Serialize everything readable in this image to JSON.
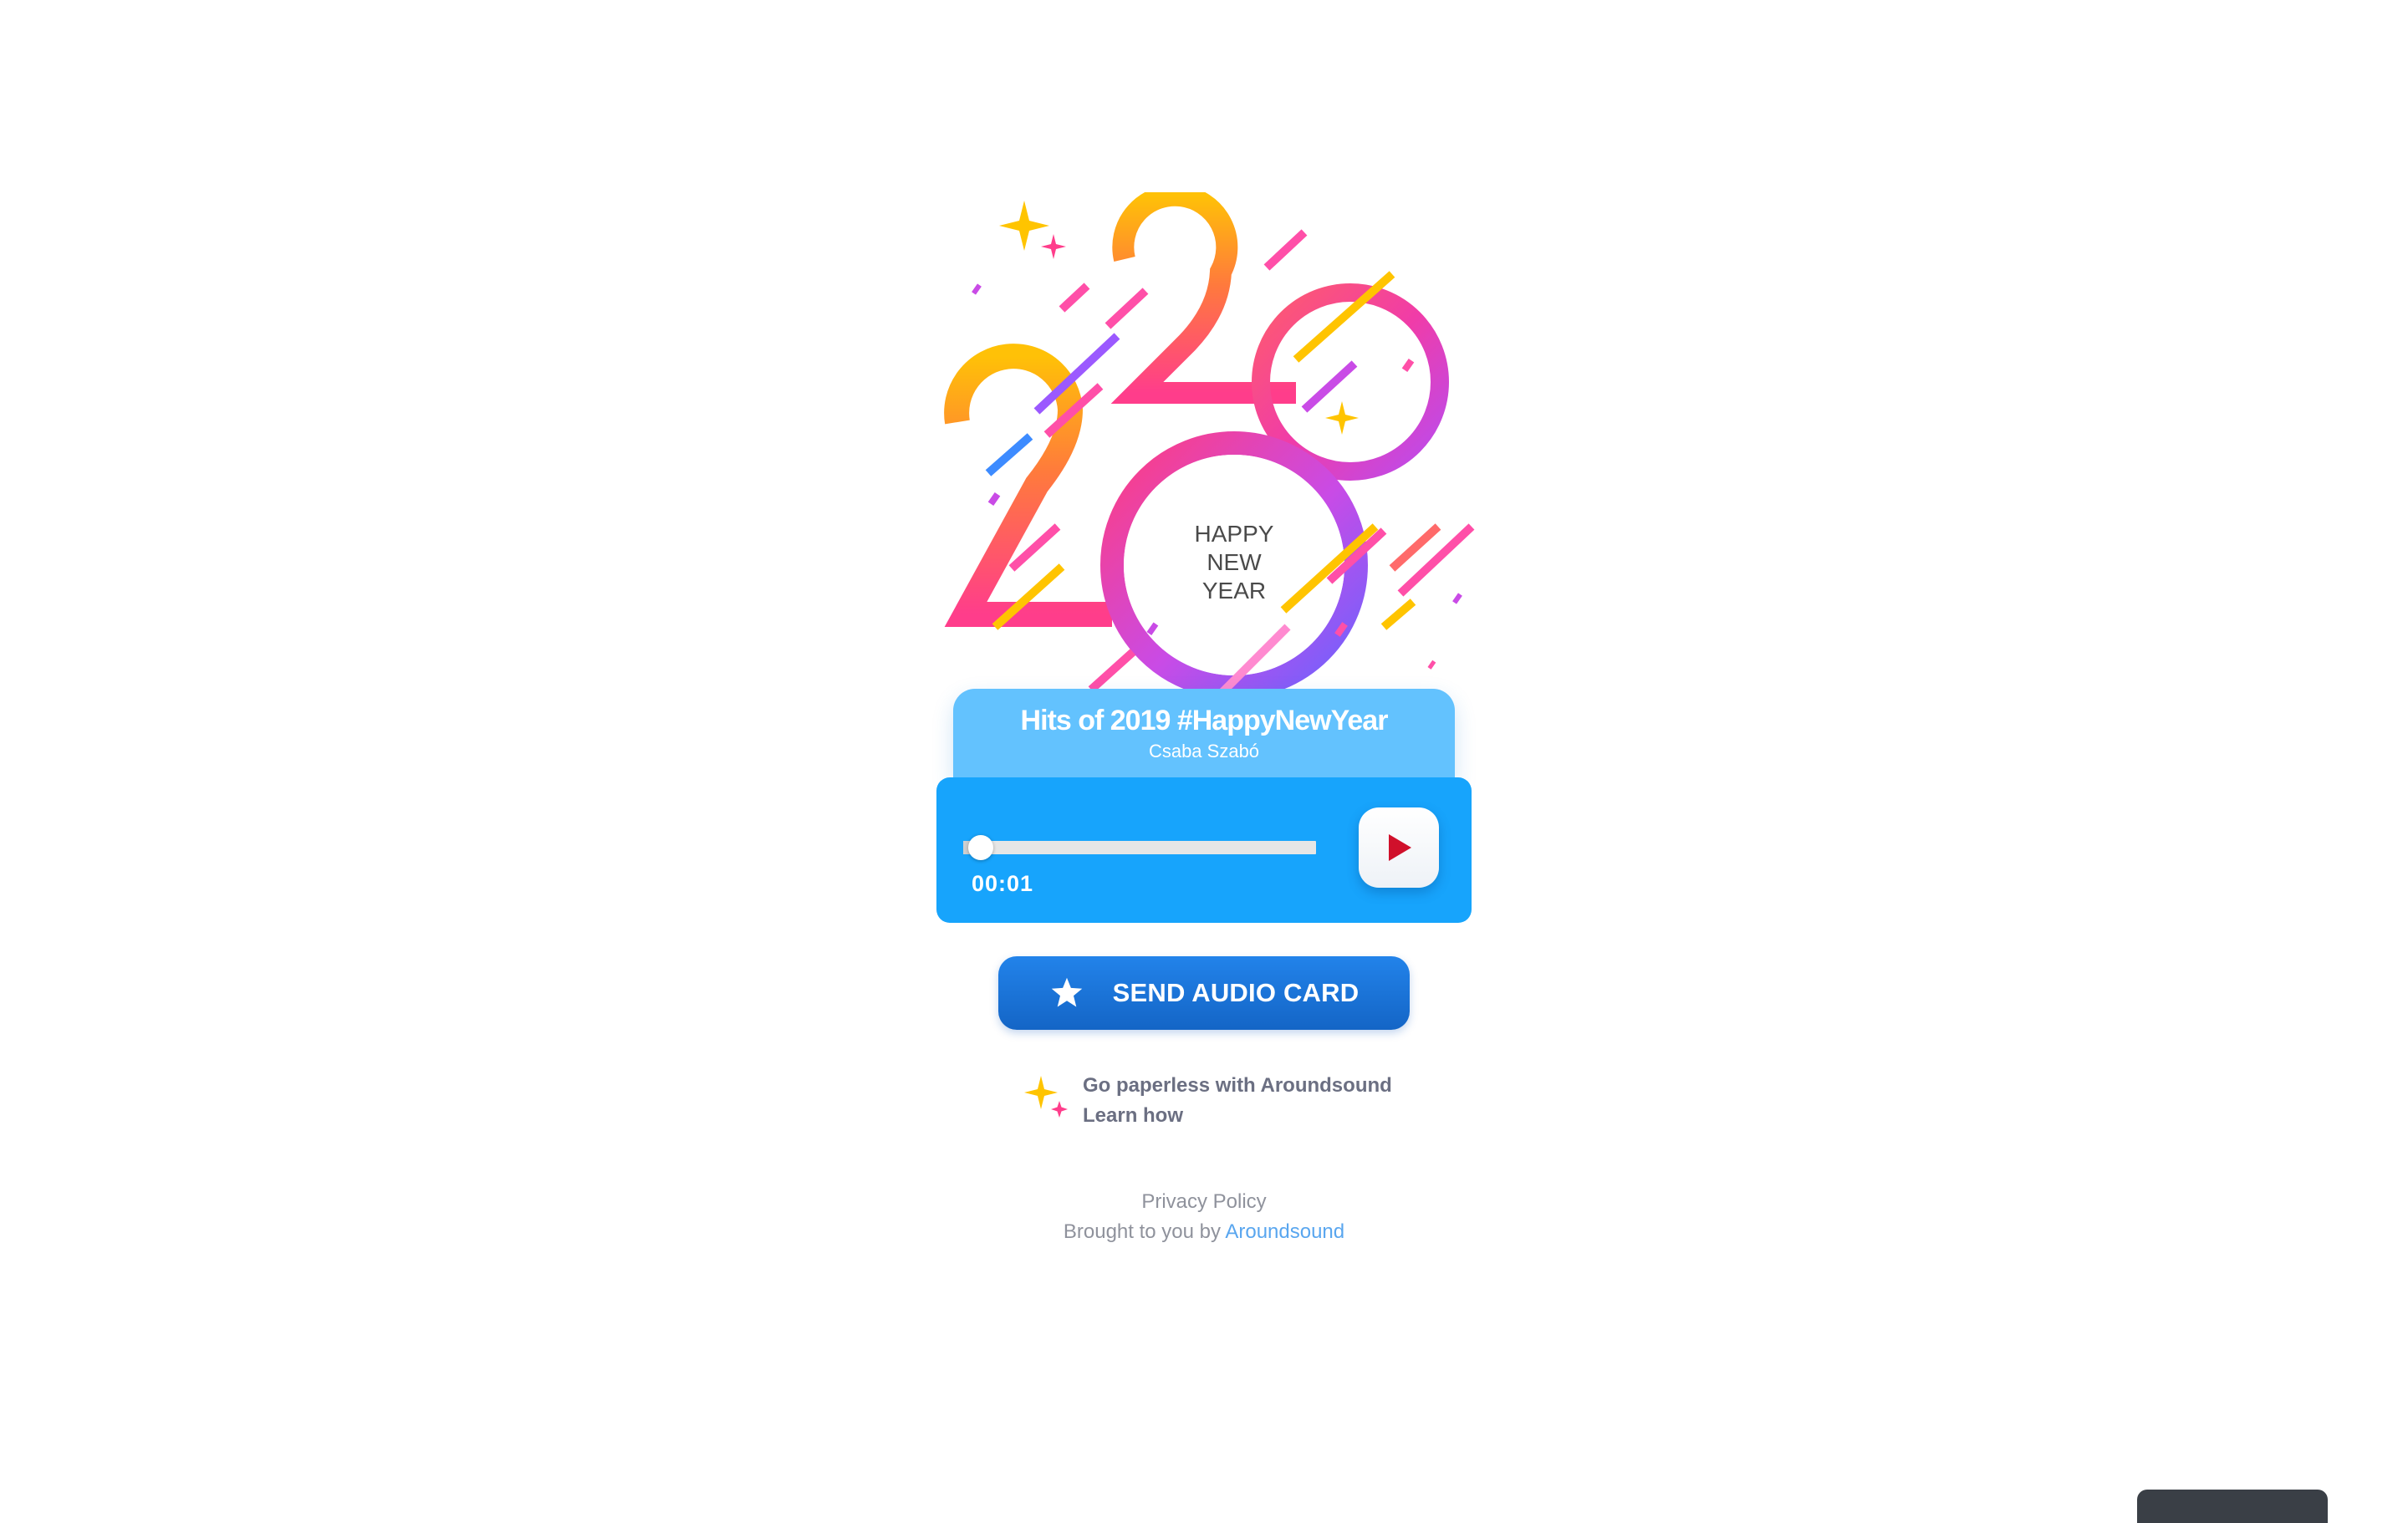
{
  "card_art": {
    "greeting_lines": [
      "HAPPY",
      "NEW",
      "YEAR"
    ],
    "year": "2020"
  },
  "track": {
    "title": "Hits of 2019 #HappyNewYear",
    "artist": "Csaba Szabó"
  },
  "player": {
    "current_time": "00:01",
    "progress_fraction": 0.05,
    "play_icon": "play-icon"
  },
  "send_button": {
    "label": "SEND AUDIO CARD",
    "icon": "star-icon"
  },
  "promo": {
    "line1": "Go paperless with Aroundsound",
    "line2": "Learn how",
    "icon": "sparkle-icon"
  },
  "footer": {
    "privacy": "Privacy Policy",
    "brought_by": "Brought to you by",
    "brand_link": "Aroundsound"
  },
  "colors": {
    "player_bg": "#17a4fc",
    "title_card_bg": "#63c2fe",
    "send_button_bg": "#1a74da",
    "play_triangle": "#d0102b",
    "link": "#59a6ef"
  }
}
